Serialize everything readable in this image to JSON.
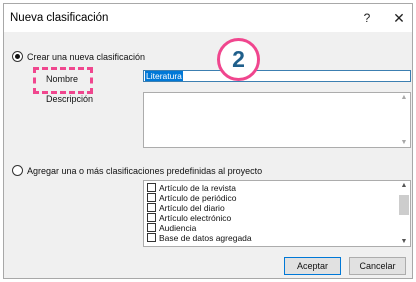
{
  "window": {
    "title": "Nueva clasificación",
    "help_glyph": "?",
    "close_glyph": "✕"
  },
  "create_section": {
    "radio_label": "Crear una nueva clasificación",
    "name_label": "Nombre",
    "name_value": "Literatura",
    "description_label": "Descripción",
    "description_value": ""
  },
  "predefined_section": {
    "radio_label": "Agregar una o más clasificaciones predefinidas al proyecto",
    "items": [
      {
        "label": "Artículo de la revista",
        "checked": false
      },
      {
        "label": "Artículo de periódico",
        "checked": false
      },
      {
        "label": "Artículo del diario",
        "checked": false
      },
      {
        "label": "Artículo electrónico",
        "checked": false
      },
      {
        "label": "Audiencia",
        "checked": false
      },
      {
        "label": "Base de datos agregada",
        "checked": false
      }
    ]
  },
  "buttons": {
    "accept": "Aceptar",
    "cancel": "Cancelar"
  },
  "annotation": {
    "step_number": "2",
    "color": "#f0468e"
  }
}
